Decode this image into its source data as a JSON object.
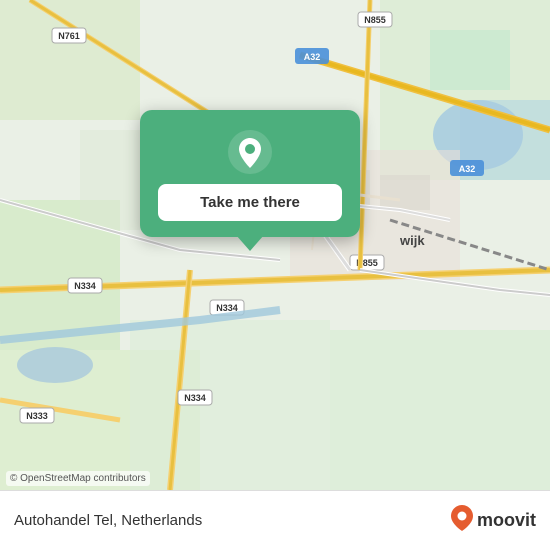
{
  "map": {
    "attribution": "© OpenStreetMap contributors",
    "background_color": "#e8efe8"
  },
  "popup": {
    "button_label": "Take me there",
    "pin_color": "white"
  },
  "infobar": {
    "location_name": "Autohandel Tel, Netherlands",
    "logo_text": "moovit",
    "logo_pin": "📍"
  }
}
